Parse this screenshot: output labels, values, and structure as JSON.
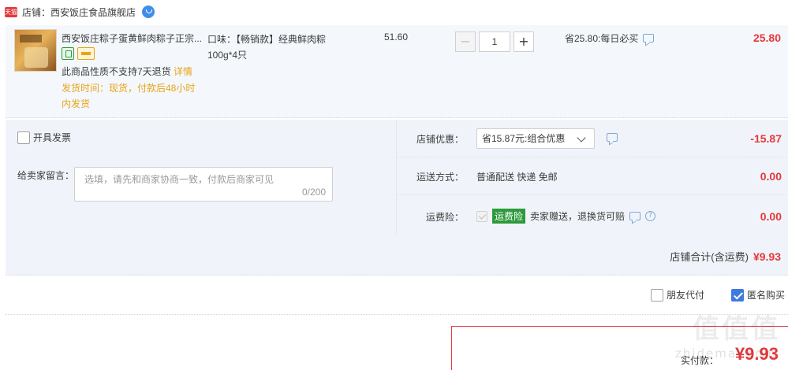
{
  "store": {
    "badge": "天猫",
    "name": "店铺：西安饭庄食品旗舰店"
  },
  "item": {
    "title": "西安饭庄粽子蛋黄鲜肉粽子正宗...",
    "return_note": "此商品性质不支持7天退货",
    "detail_link": "详情",
    "ship_time": "发货时间：现货，付款后48小时内发货",
    "spec": "口味：【畅销款】经典鲜肉粽100g*4只",
    "unit_price": "51.60",
    "quantity": "1",
    "minus": "−",
    "plus": "+",
    "promo": "省25.80:每日必买",
    "line_total": "25.80"
  },
  "options": {
    "invoice_label": "开具发票",
    "message_label": "给卖家留言：",
    "message_placeholder": "选填，请先和商家协商一致，付款后商家可见",
    "message_count": "0/200",
    "store_discount_label": "店铺优惠：",
    "store_discount_value": "省15.87元:组合优惠",
    "store_discount_amount": "-15.87",
    "shipping_label": "运送方式：",
    "shipping_value": "普通配送 快递 免邮",
    "shipping_amount": "0.00",
    "insurance_label": "运费险：",
    "insurance_tag": "运费险",
    "insurance_text": "卖家赠送，退换货可赔",
    "insurance_amount": "0.00",
    "insurance_help": "?",
    "subtotal_label": "店铺合计(含运费)",
    "subtotal_amount": "¥9.93"
  },
  "payment": {
    "friend_pay": "朋友代付",
    "anonymous": "匿名购买",
    "pay_label": "实付款：",
    "pay_amount": "¥9.93"
  },
  "watermark": {
    "main": "值值值",
    "sub": "zhidemai.com"
  },
  "colors": {
    "accent_red": "#e4393c",
    "panel_bg": "#f4f8fc",
    "check_blue": "#3e7ae0",
    "insure_green": "#2d9a3b"
  }
}
